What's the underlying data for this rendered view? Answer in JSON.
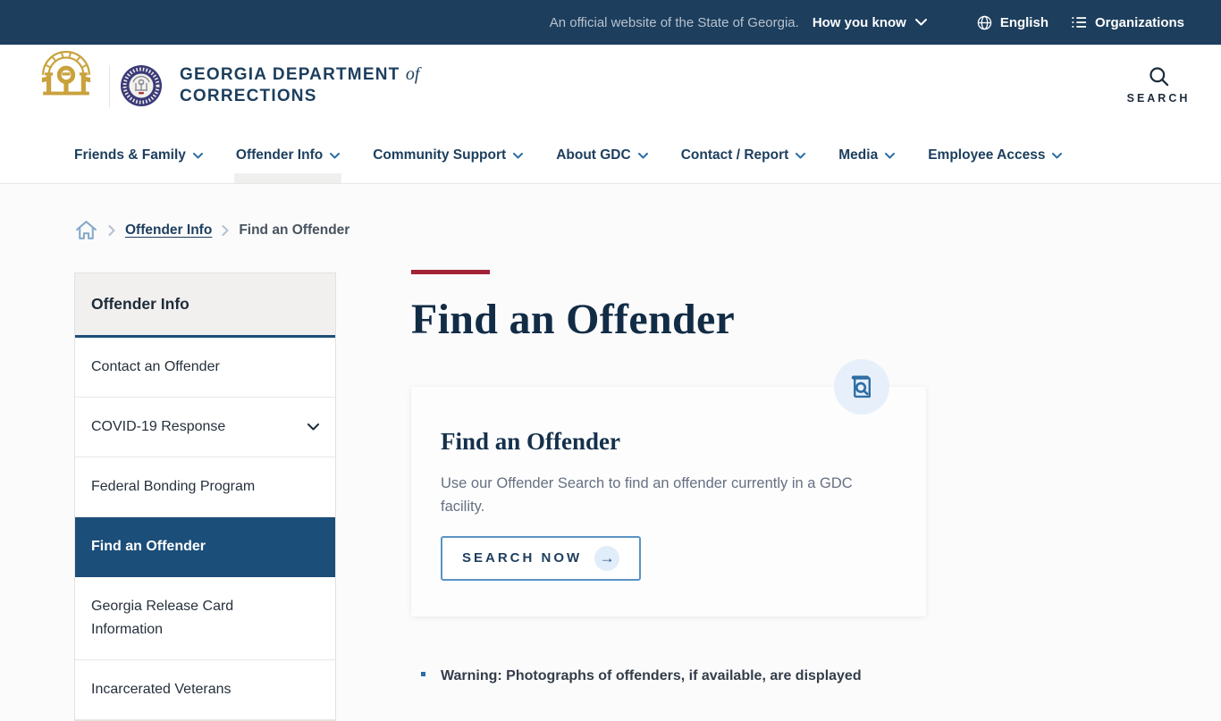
{
  "topbar": {
    "official_text": "An official website of the State of Georgia.",
    "how_you_know_label": "How you know",
    "language_label": "English",
    "organizations_label": "Organizations"
  },
  "header": {
    "brand_line1": "GEORGIA DEPARTMENT",
    "brand_of": "of",
    "brand_line2": "CORRECTIONS",
    "search_label": "SEARCH"
  },
  "nav": {
    "items": [
      {
        "label": "Friends & Family"
      },
      {
        "label": "Offender Info"
      },
      {
        "label": "Community Support"
      },
      {
        "label": "About GDC"
      },
      {
        "label": "Contact / Report"
      },
      {
        "label": "Media"
      },
      {
        "label": "Employee Access"
      }
    ],
    "active_item": "Offender Info"
  },
  "breadcrumb": {
    "parent": "Offender Info",
    "current": "Find an Offender"
  },
  "sidebar": {
    "title": "Offender Info",
    "items": [
      {
        "label": "Contact an Offender"
      },
      {
        "label": "COVID-19 Response"
      },
      {
        "label": "Federal Bonding Program"
      },
      {
        "label": "Find an Offender"
      },
      {
        "label": "Georgia Release Card Information"
      },
      {
        "label": "Incarcerated Veterans"
      }
    ],
    "active_item": "Find an Offender"
  },
  "main": {
    "page_title": "Find an Offender",
    "card": {
      "heading": "Find an Offender",
      "body": "Use our Offender Search to find an offender currently in a GDC facility.",
      "button_label": "SEARCH NOW"
    },
    "warning_item": "Warning: Photographs of offenders, if available, are displayed"
  },
  "colors": {
    "topbar_navy": "#1d3e5d",
    "nav_text": "#1c3e5d",
    "active_sidebar_blue": "#1b4e79",
    "accent_blue": "#2d6ea5",
    "accent_red": "#a22335",
    "gold_logo": "#c9a23c",
    "icon_circle_bg": "#e7f0fa"
  }
}
